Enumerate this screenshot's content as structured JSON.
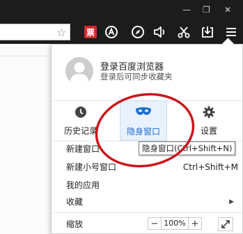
{
  "window": {
    "minimize_glyph": "—",
    "maximize_glyph": "❐",
    "close_glyph": "✕"
  },
  "toolbar": {
    "bookmark_icon": "star-icon",
    "ticket_label": "票",
    "buttons": [
      "ticket-icon",
      "adblock-icon",
      "compass-icon",
      "volume-icon",
      "scissors-icon",
      "download-icon",
      "menu-icon"
    ]
  },
  "account": {
    "title": "登录百度浏览器",
    "subtitle": "登录后可同步收藏夹"
  },
  "quick_actions": [
    {
      "label": "历史记录",
      "icon": "clock-icon"
    },
    {
      "label": "隐身窗口",
      "icon": "mask-icon",
      "active": true
    },
    {
      "label": "设置",
      "icon": "gear-icon"
    }
  ],
  "menu_items": [
    {
      "label": "新建窗口",
      "shortcut": ""
    },
    {
      "label": "新建小号窗口",
      "shortcut": "Ctrl+Shift+M"
    },
    {
      "label": "我的应用",
      "shortcut": ""
    },
    {
      "label": "收藏",
      "shortcut": "",
      "submenu": "▶"
    }
  ],
  "zoom": {
    "label": "缩放",
    "minus": "−",
    "value": "100%",
    "plus": "+"
  },
  "tooltip": {
    "text": "隐身窗口(Ctrl+Shift+N)"
  },
  "colors": {
    "active_blue": "#1f6fc9",
    "annotation_red": "#c8171e",
    "ticket_red": "#d8262c"
  }
}
